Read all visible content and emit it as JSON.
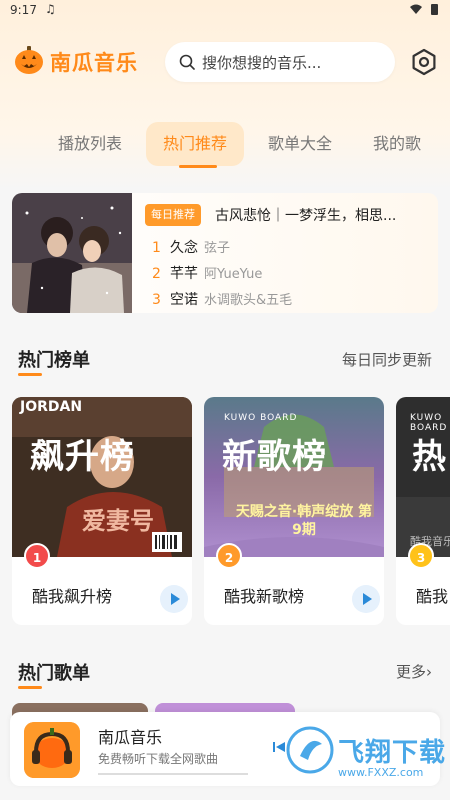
{
  "status": {
    "time": "9:17",
    "note_icon": "♫"
  },
  "header": {
    "app_title": "南瓜音乐",
    "search_placeholder": "搜你想搜的音乐..."
  },
  "tabs": [
    {
      "label": "播放列表"
    },
    {
      "label": "热门推荐"
    },
    {
      "label": "歌单大全"
    },
    {
      "label": "我的歌"
    }
  ],
  "daily": {
    "badge": "每日推荐",
    "title": "古风悲怆｜一梦浮生，相思...",
    "songs": [
      {
        "rank": "1",
        "name": "久念",
        "artist": "弦子"
      },
      {
        "rank": "2",
        "name": "芊芊",
        "artist": "阿YueYue"
      },
      {
        "rank": "3",
        "name": "空诺",
        "artist": "水调歌头&五毛"
      }
    ]
  },
  "hot_charts": {
    "title": "热门榜单",
    "right": "每日同步更新",
    "items": [
      {
        "rank": "1",
        "cover_title": "飙升榜",
        "kuwo": "KUWO BOARD",
        "cover_top_text": "JORDAN",
        "cover_sub_text": "爱妻号",
        "name": "酷我飙升榜",
        "badge_color": "#f24b4b"
      },
      {
        "rank": "2",
        "cover_title": "新歌榜",
        "kuwo": "KUWO BOARD",
        "cover_sub_text": "天赐之音·韩声绽放 第9期",
        "name": "酷我新歌榜",
        "badge_color": "#ff9a2a"
      },
      {
        "rank": "3",
        "cover_title": "热",
        "kuwo": "KUWO BOARD",
        "cover_sub_text": "酷我音乐",
        "name": "酷我",
        "badge_color": "#ffc21a"
      }
    ]
  },
  "hot_playlists": {
    "title": "热门歌单",
    "right": "更多›"
  },
  "player": {
    "title": "南瓜音乐",
    "subtitle": "免费畅听下载全网歌曲"
  },
  "watermark": {
    "text": "飞翔下载",
    "url": "www.FXXZ.com"
  },
  "colors": {
    "accent": "#ff8a1a",
    "rank1": "#f24b4b",
    "rank2": "#ff9a2a",
    "rank3": "#ffc21a",
    "watermark": "#4aa8e8"
  }
}
